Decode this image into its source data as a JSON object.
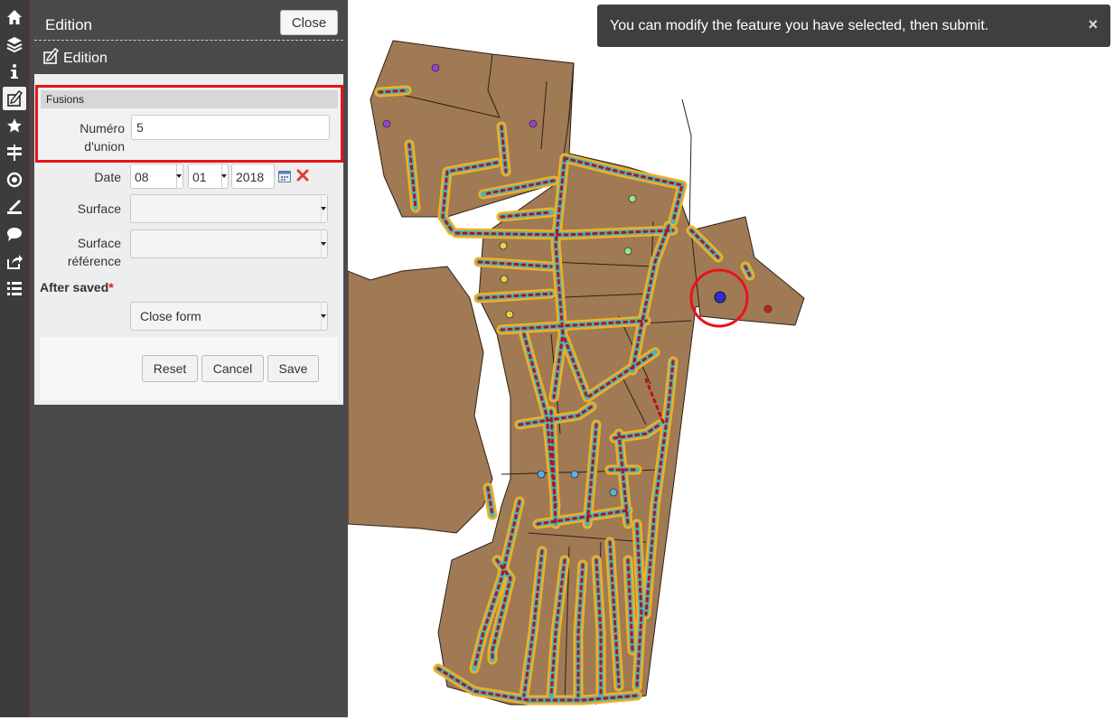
{
  "toolbar": {
    "items": [
      {
        "name": "home-icon"
      },
      {
        "name": "layers-icon"
      },
      {
        "name": "info-icon"
      },
      {
        "name": "edition-icon",
        "active": true
      },
      {
        "name": "star-icon"
      },
      {
        "name": "signpost-icon"
      },
      {
        "name": "locate-icon"
      },
      {
        "name": "measure-icon"
      },
      {
        "name": "comment-icon"
      },
      {
        "name": "share-icon"
      },
      {
        "name": "list-icon"
      }
    ]
  },
  "panel": {
    "title": "Edition",
    "close_label": "Close",
    "subtitle": "Edition"
  },
  "form": {
    "fieldset_legend": "Fusions",
    "numero_label_1": "Numéro",
    "numero_label_2": "d'union",
    "numero_value": "5",
    "date_label": "Date",
    "date_day": "08",
    "date_month": "01",
    "date_year": "2018",
    "surface_label": "Surface",
    "surface_ref_label_1": "Surface",
    "surface_ref_label_2": "référence",
    "after_saved_label": "After saved",
    "after_saved_required": "*",
    "after_saved_value": "Close form",
    "reset_label": "Reset",
    "cancel_label": "Cancel",
    "save_label": "Save"
  },
  "notification": {
    "message": "You can modify the feature you have selected, then submit.",
    "close_glyph": "×"
  },
  "colors": {
    "parcel_fill": "#a07a55",
    "path_outline": "#f2b01e",
    "path_inner": "#4db3b8",
    "vertex": "#b5121b",
    "highlight": "#e8131a",
    "selected_point": "#2c2fd6"
  }
}
